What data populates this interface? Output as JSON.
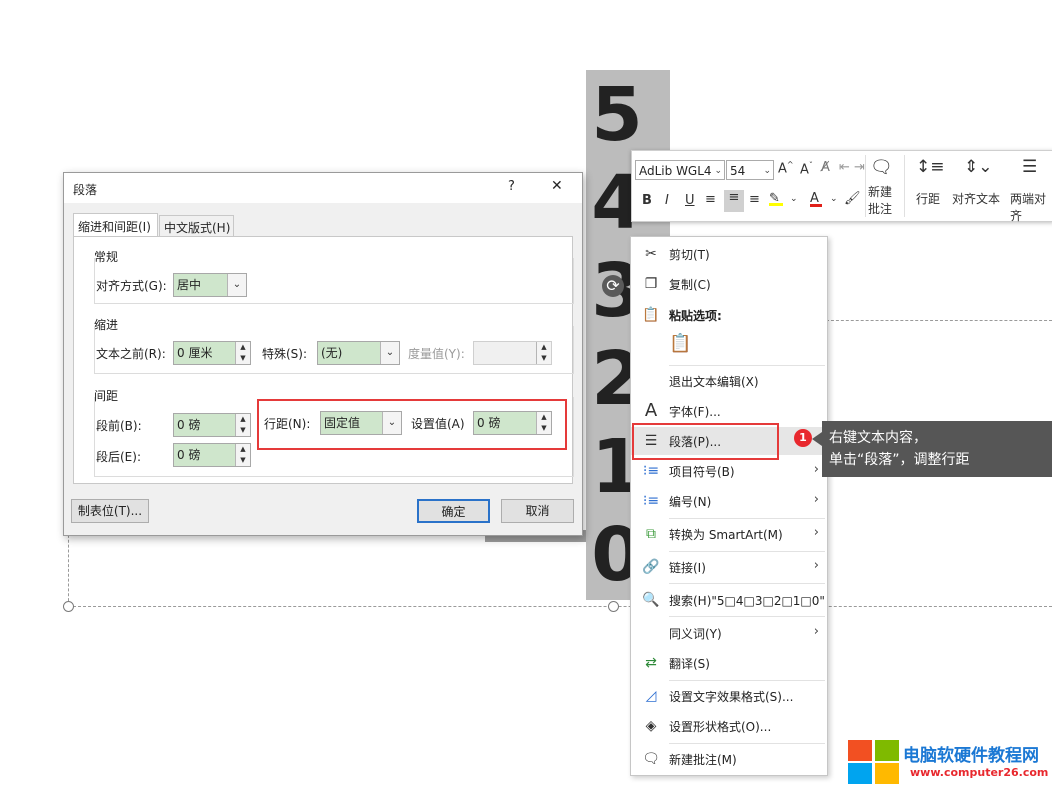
{
  "slide": {
    "digits": [
      "5",
      "4",
      "3",
      "2",
      "1",
      "0"
    ]
  },
  "mini_toolbar": {
    "font_name": "AdLib WGL4",
    "font_size": "54",
    "new_comment_label_1": "新建",
    "new_comment_label_2": "批注",
    "line_spacing_label": "行距",
    "align_text_label": "对齐文本",
    "justify_label": "两端对齐",
    "bold": "B",
    "italic": "I",
    "underline": "U"
  },
  "context_menu": {
    "items": [
      {
        "label": "剪切(T)"
      },
      {
        "label": "复制(C)"
      },
      {
        "label": "粘贴选项:"
      },
      {
        "label": "退出文本编辑(X)"
      },
      {
        "label": "字体(F)..."
      },
      {
        "label": "段落(P)..."
      },
      {
        "label": "项目符号(B)"
      },
      {
        "label": "编号(N)"
      },
      {
        "label": "转换为 SmartArt(M)"
      },
      {
        "label": "链接(I)"
      },
      {
        "label": "搜索(H)\"5□4□3□2□1□0\""
      },
      {
        "label": "同义词(Y)"
      },
      {
        "label": "翻译(S)"
      },
      {
        "label": "设置文字效果格式(S)..."
      },
      {
        "label": "设置形状格式(O)..."
      },
      {
        "label": "新建批注(M)"
      }
    ]
  },
  "callout": {
    "badge": "1",
    "line1": "右键文本内容，",
    "line2": "单击“段落”，调整行距"
  },
  "dialog": {
    "title": "段落",
    "help": "?",
    "close": "✕",
    "tabs": [
      "缩进和间距(I)",
      "中文版式(H)"
    ],
    "general": {
      "group_label": "常规",
      "alignment_label": "对齐方式(G):",
      "alignment_value": "居中"
    },
    "indent": {
      "group_label": "缩进",
      "before_text_label": "文本之前(R):",
      "before_text_value": "0 厘米",
      "special_label": "特殊(S):",
      "special_value": "(无)",
      "by_label": "度量值(Y):",
      "by_value": ""
    },
    "spacing": {
      "group_label": "间距",
      "before_label": "段前(B):",
      "before_value": "0 磅",
      "after_label": "段后(E):",
      "after_value": "0 磅",
      "line_spacing_label": "行距(N):",
      "line_spacing_value": "固定值",
      "at_label": "设置值(A)",
      "at_value": "0 磅"
    },
    "tabs_button": "制表位(T)...",
    "ok_button": "确定",
    "cancel_button": "取消"
  },
  "watermark": {
    "name": "电脑软硬件教程网",
    "url": "www.computer26.com"
  }
}
